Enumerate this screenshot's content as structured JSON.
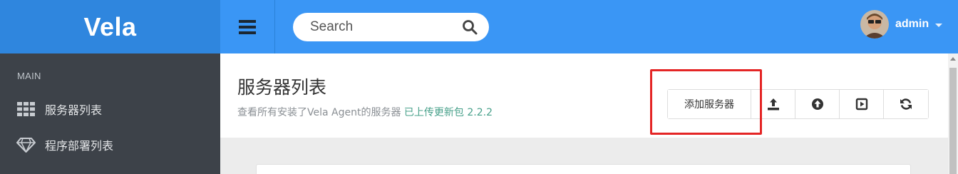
{
  "brand": {
    "name": "Vela"
  },
  "header": {
    "search": {
      "placeholder": "Search"
    },
    "user": {
      "name": "admin"
    }
  },
  "sidebar": {
    "section": "MAIN",
    "items": [
      {
        "label": "服务器列表",
        "icon": "grid-icon"
      },
      {
        "label": "程序部署列表",
        "icon": "diamond-icon"
      }
    ]
  },
  "page": {
    "title": "服务器列表",
    "subtitle": "查看所有安装了Vela Agent的服务器",
    "subtitle_highlight": "已上传更新包 2.2.2"
  },
  "toolbar": {
    "add_server_label": "添加服务器",
    "icon_buttons": [
      "upload-icon",
      "arrow-up-circle-icon",
      "play-square-icon",
      "refresh-icon"
    ]
  },
  "colors": {
    "header": "#3a96f5",
    "brand_bg": "#2f86de",
    "sidebar": "#3d4249",
    "subtitle_highlight": "#47a08a",
    "annotation_box": "#e42525"
  }
}
